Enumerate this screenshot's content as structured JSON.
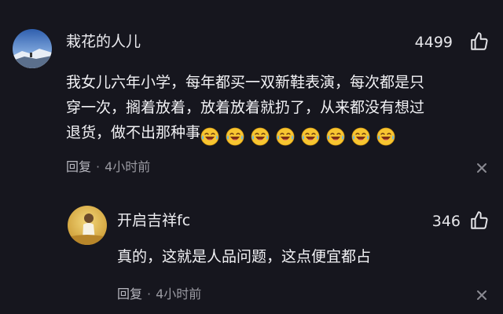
{
  "comment": {
    "author": "栽花的人儿",
    "likes": "4499",
    "text": "我女儿六年小学，每年都买一双新鞋表演，每次都是只穿一次，搁着放着，放着放着就扔了，从来都没有想过退货，做不出那种事",
    "emoji": "laughing-crying-face",
    "emoji_count": 8,
    "reply_label": "回复",
    "separator": "·",
    "time": "4小时前"
  },
  "reply": {
    "author": "开启吉祥fc",
    "likes": "346",
    "text": "真的，这就是人品问题，这点便宜都占",
    "reply_label": "回复",
    "separator": "·",
    "time": "4小时前"
  },
  "colors": {
    "background": "#16161e",
    "text": "#f2f2f5",
    "meta": "#9a9aa2"
  }
}
